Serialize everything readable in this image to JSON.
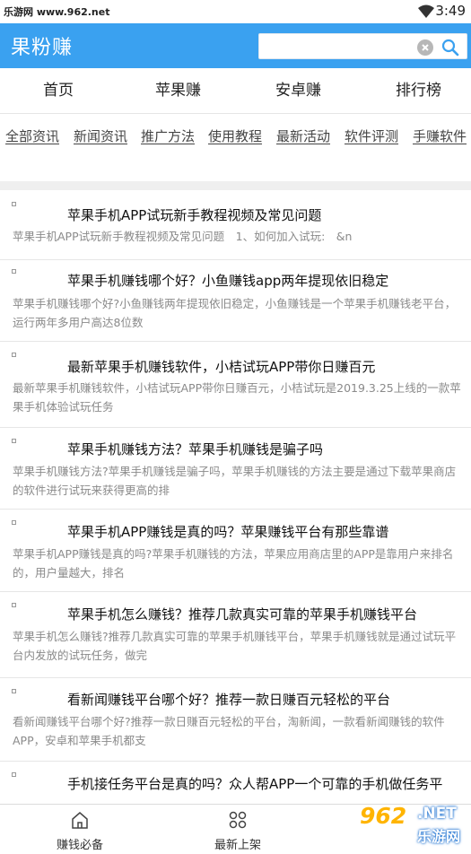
{
  "status_bar": {
    "carrier": "乐游网 www.962.net",
    "time": "3:49"
  },
  "header": {
    "title": "果粉赚",
    "search_value": ""
  },
  "nav_tabs": [
    "首页",
    "苹果赚",
    "安卓赚",
    "排行榜"
  ],
  "categories": [
    "全部资讯",
    "新闻资讯",
    "推广方法",
    "使用教程",
    "最新活动",
    "软件评测",
    "手赚软件"
  ],
  "articles": [
    {
      "title": "苹果手机APP试玩新手教程视频及常见问题",
      "desc": "苹果手机APP试玩新手教程视频及常见问题　1、如何加入试玩:　&n"
    },
    {
      "title": "苹果手机赚钱哪个好？小鱼赚钱app两年提现依旧稳定",
      "desc": "苹果手机赚钱哪个好?小鱼赚钱两年提现依旧稳定，小鱼赚钱是一个苹果手机赚钱老平台，运行两年多用户高达8位数"
    },
    {
      "title": "最新苹果手机赚钱软件，小桔试玩APP带你日赚百元",
      "desc": "最新苹果手机赚钱软件，小桔试玩APP带你日赚百元，小桔试玩是2019.3.25上线的一款苹果手机体验试玩任务"
    },
    {
      "title": "苹果手机赚钱方法？苹果手机赚钱是骗子吗",
      "desc": "苹果手机赚钱方法?苹果手机赚钱是骗子吗，苹果手机赚钱的方法主要是通过下载苹果商店的软件进行试玩来获得更高的排"
    },
    {
      "title": "苹果手机APP赚钱是真的吗？苹果赚钱平台有那些靠谱",
      "desc": "苹果手机APP赚钱是真的吗?苹果手机赚钱的方法，苹果应用商店里的APP是靠用户来排名的，用户量越大，排名"
    },
    {
      "title": "苹果手机怎么赚钱？推荐几款真实可靠的苹果手机赚钱平台",
      "desc": "苹果手机怎么赚钱?推荐几款真实可靠的苹果手机赚钱平台，苹果手机赚钱就是通过试玩平台内发放的试玩任务，做完"
    },
    {
      "title": "看新闻赚钱平台哪个好？推荐一款日赚百元轻松的平台",
      "desc": "看新闻赚钱平台哪个好?推荐一款日赚百元轻松的平台，淘新闻，一款看新闻赚钱的软件APP，安卓和苹果手机都支"
    },
    {
      "title": "手机接任务平台是真的吗？众人帮APP一个可靠的手机做任务平",
      "desc": ""
    }
  ],
  "bottom_nav": [
    "赚钱必备",
    "最新上架"
  ],
  "watermark": {
    "brand": "962",
    "net": ".NET",
    "cn": "乐游网"
  },
  "colors": {
    "header": "#3aa1f0",
    "watermark_orange": "#ffb400"
  }
}
